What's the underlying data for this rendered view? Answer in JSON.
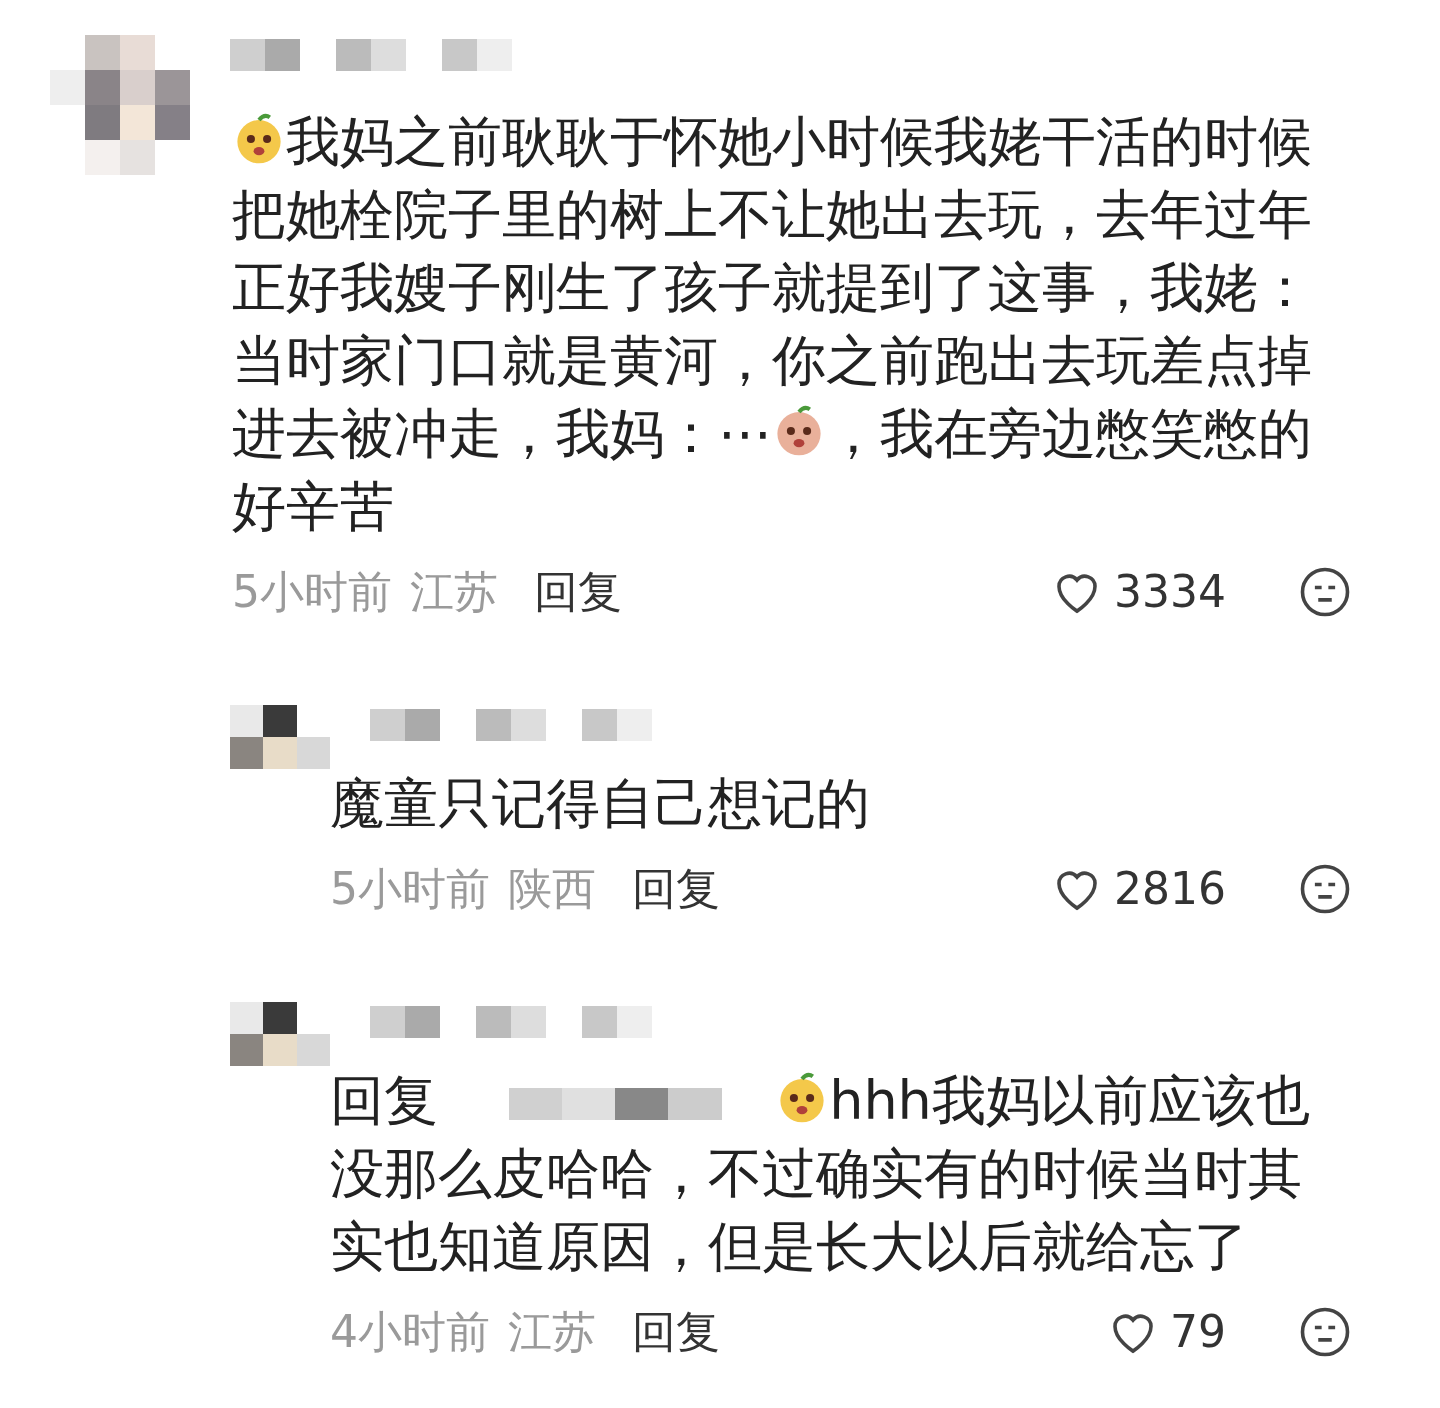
{
  "comments": [
    {
      "reply": false,
      "segments": [
        {
          "kind": "emoji"
        },
        {
          "kind": "text",
          "text": "我妈之前耿耿于怀她小时候我姥干活的时候把她栓院子里的树上不让她出去玩，去年过年正好我嫂子刚生了孩子就提到了这事，我姥：当时家门口就是黄河，你之前跑出去玩差点掉进去被冲走，我妈：⋯"
        },
        {
          "kind": "emoji"
        },
        {
          "kind": "text",
          "text": "，我在旁边憋笑憋的好辛苦"
        }
      ],
      "time": "5小时前",
      "location": "江苏",
      "reply_label": "回复",
      "likes": "3334"
    },
    {
      "reply": true,
      "segments": [
        {
          "kind": "text",
          "text": "魔童只记得自己想记的"
        }
      ],
      "time": "5小时前",
      "location": "陕西",
      "reply_label": "回复",
      "likes": "2816"
    },
    {
      "reply": true,
      "segments": [
        {
          "kind": "text",
          "text": "回复 "
        },
        {
          "kind": "mention"
        },
        {
          "kind": "emoji"
        },
        {
          "kind": "text",
          "text": "hhh我妈以前应该也没那么皮哈哈，不过确实有的时候当时其实也知道原因，但是长大以后就给忘了"
        }
      ],
      "time": "4小时前",
      "location": "江苏",
      "reply_label": "回复",
      "likes": "79"
    }
  ]
}
